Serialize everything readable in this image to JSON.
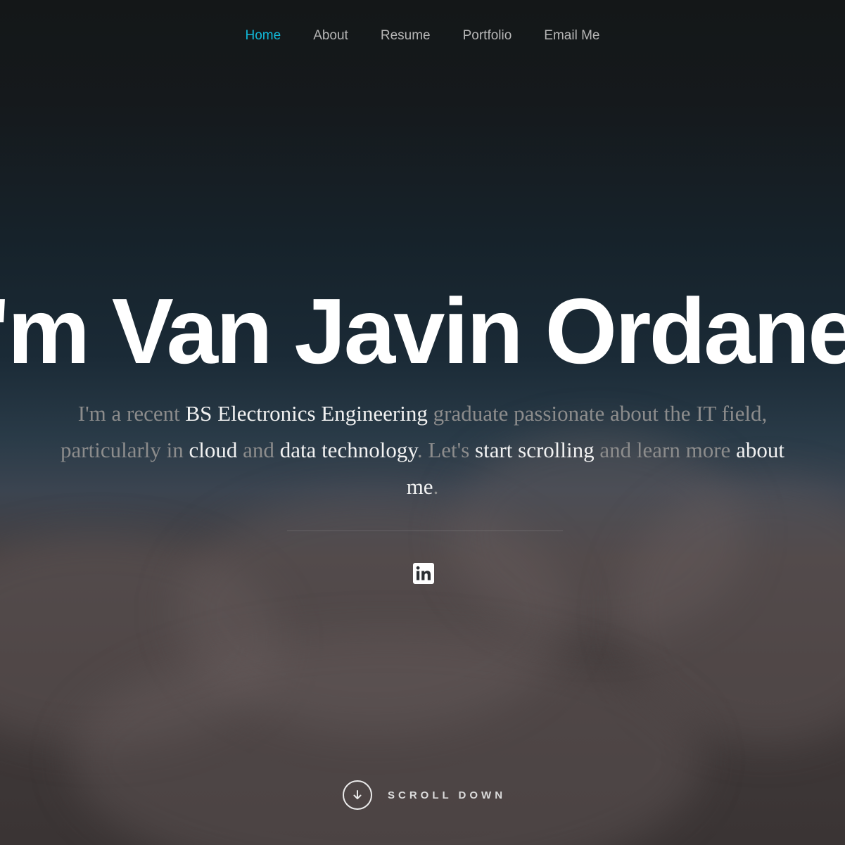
{
  "nav": {
    "items": [
      {
        "label": "Home",
        "active": true
      },
      {
        "label": "About",
        "active": false
      },
      {
        "label": "Resume",
        "active": false
      },
      {
        "label": "Portfolio",
        "active": false
      },
      {
        "label": "Email Me",
        "active": false
      }
    ]
  },
  "hero": {
    "headline": "I'm Van Javin Ordanel",
    "intro": {
      "parts": [
        {
          "text": "I'm a recent ",
          "highlight": false
        },
        {
          "text": "BS Electronics Engineering",
          "highlight": true
        },
        {
          "text": " graduate passionate about the IT field, particularly in ",
          "highlight": false
        },
        {
          "text": "cloud",
          "highlight": true
        },
        {
          "text": " and ",
          "highlight": false
        },
        {
          "text": "data technology",
          "highlight": true
        },
        {
          "text": ". Let's ",
          "highlight": false
        },
        {
          "text": "start scrolling",
          "highlight": true
        },
        {
          "text": " and learn more ",
          "highlight": false
        },
        {
          "text": "about me",
          "highlight": true
        },
        {
          "text": ".",
          "highlight": false
        }
      ]
    },
    "social": {
      "icon": "linkedin-icon"
    },
    "scroll_down": {
      "label": "SCROLL DOWN",
      "icon": "arrow-down-icon"
    }
  },
  "colors": {
    "accent": "#11b8d8",
    "nav_text": "#b6b6b6",
    "headline": "#ffffff",
    "intro_muted": "#8c8c8c",
    "intro_highlight": "#f2f2f2"
  }
}
